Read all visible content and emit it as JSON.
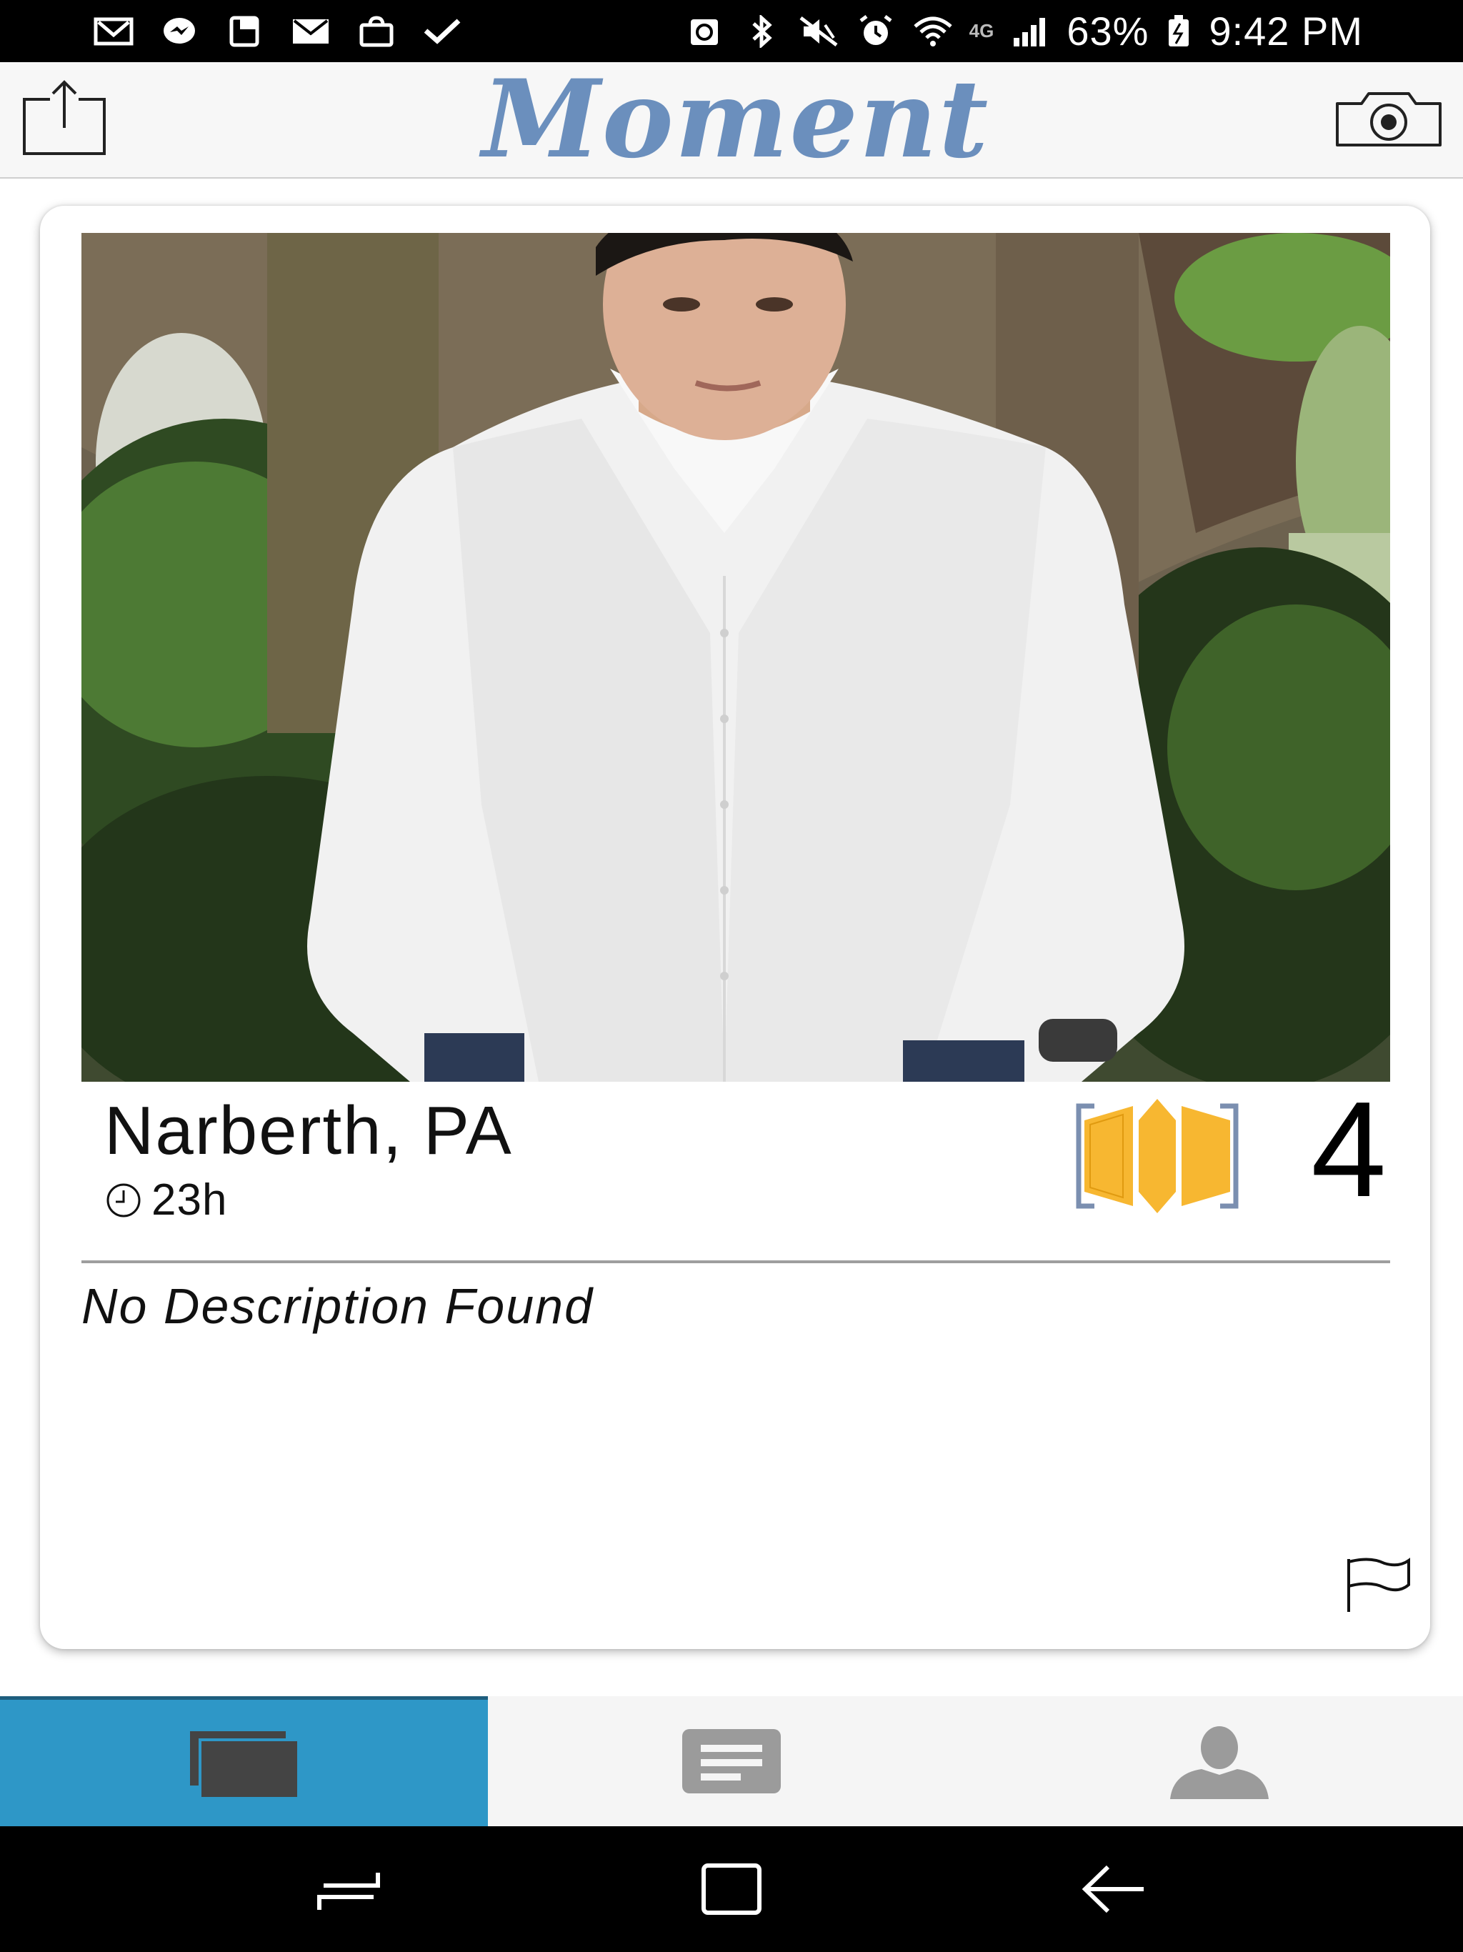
{
  "status_bar": {
    "left_icons": [
      "gmail-icon",
      "messenger-icon",
      "wallet-icon",
      "mail-icon",
      "shopping-bag-icon",
      "inbox-check-icon"
    ],
    "right_icons": [
      "recycle-icon",
      "bluetooth-icon",
      "mute-icon",
      "alarm-icon",
      "wifi-icon",
      "signal-icon",
      "battery-icon"
    ],
    "network": "4G",
    "battery": "63%",
    "time": "9:42 PM"
  },
  "header": {
    "app_name": "Moment",
    "share_icon": "share-icon",
    "camera_icon": "camera-icon",
    "logo_color": "#6b8fbd"
  },
  "card": {
    "photo_icon": "profile-photo",
    "location": "Narberth, PA",
    "age": "23h",
    "score": "4",
    "description": "No Description Found",
    "hourglass_color": "#f7b731",
    "hourglass_frame_color": "#7b8fb0"
  },
  "tabs": [
    {
      "icon": "cards-icon",
      "active": true
    },
    {
      "icon": "messages-icon",
      "active": false
    },
    {
      "icon": "profile-icon",
      "active": false
    }
  ],
  "tab_active_color": "#2e97c7",
  "nav": [
    "recent-apps-icon",
    "home-icon",
    "back-icon"
  ]
}
